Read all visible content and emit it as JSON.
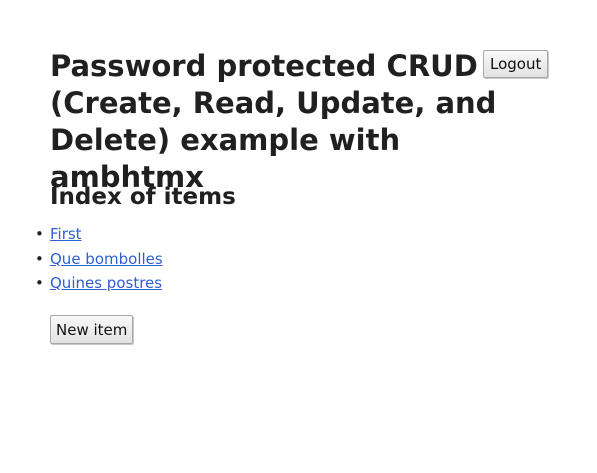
{
  "header": {
    "title": "Password protected CRUD (Create, Read, Update, and Delete) example with ambhtmx",
    "logout_label": "Logout"
  },
  "main": {
    "heading": "Index of items",
    "items": [
      {
        "label": "First"
      },
      {
        "label": "Que bombolles"
      },
      {
        "label": "Quines postres"
      }
    ],
    "new_item_label": "New item"
  },
  "colors": {
    "link": "#2f5fd0",
    "text": "#202020",
    "background": "#ffffff"
  }
}
